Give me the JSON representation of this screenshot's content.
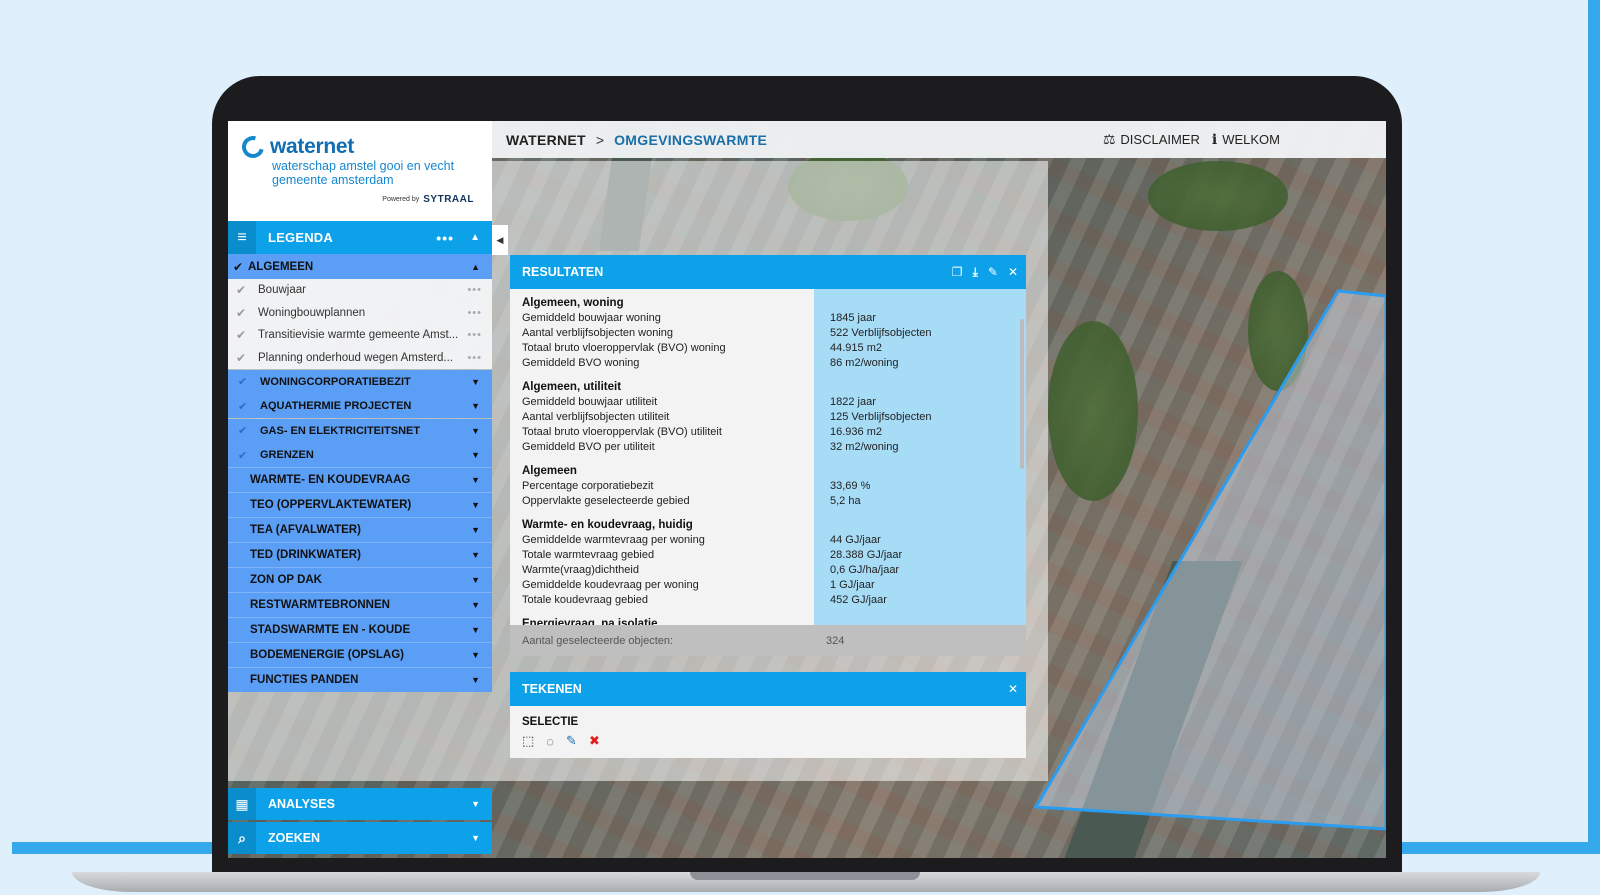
{
  "header": {
    "crumb_root": "WATERNET",
    "crumb_sep": ">",
    "crumb_current": "OMGEVINGSWARMTE",
    "disclaimer": "DISCLAIMER",
    "welkom": "WELKOM"
  },
  "logo": {
    "name": "waternet",
    "sub1": "waterschap amstel gooi en vecht",
    "sub2": "gemeente amsterdam",
    "powered_by": "Powered by",
    "vendor": "SYTRAAL"
  },
  "legend": {
    "title": "LEGENDA",
    "top": "ALGEMEEN",
    "sub_items": [
      "Bouwjaar",
      "Woningbouwplannen",
      "Transitievisie warmte gemeente Amst...",
      "Planning onderhoud wegen Amsterd..."
    ],
    "groups": [
      "WONINGCORPORATIEBEZIT",
      "AQUATHERMIE PROJECTEN",
      "GAS- EN ELEKTRICITEITSNET",
      "GRENZEN"
    ],
    "main": [
      "WARMTE- EN KOUDEVRAAG",
      "TEO (OPPERVLAKTEWATER)",
      "TEA (AFVALWATER)",
      "TED (DRINKWATER)",
      "ZON OP DAK",
      "RESTWARMTEBRONNEN",
      "STADSWARMTE EN - KOUDE",
      "BODEMENERGIE (OPSLAG)",
      "FUNCTIES PANDEN"
    ]
  },
  "bottom": {
    "analyses": "ANALYSES",
    "zoeken": "ZOEKEN"
  },
  "results": {
    "title": "RESULTATEN",
    "sections": [
      {
        "title": "Algemeen, woning",
        "rows": [
          {
            "k": "Gemiddeld bouwjaar woning",
            "v": "1845 jaar"
          },
          {
            "k": "Aantal verblijfsobjecten woning",
            "v": "522 Verblijfsobjecten"
          },
          {
            "k": "Totaal bruto vloeroppervlak (BVO) woning",
            "v": "44.915 m2"
          },
          {
            "k": "Gemiddeld BVO woning",
            "v": "86 m2/woning"
          }
        ]
      },
      {
        "title": "Algemeen, utiliteit",
        "rows": [
          {
            "k": "Gemiddeld bouwjaar utiliteit",
            "v": "1822 jaar"
          },
          {
            "k": "Aantal verblijfsobjecten utiliteit",
            "v": "125 Verblijfsobjecten"
          },
          {
            "k": "Totaal bruto vloeroppervlak (BVO) utiliteit",
            "v": "16.936 m2"
          },
          {
            "k": "Gemiddeld BVO per utiliteit",
            "v": "32 m2/woning"
          }
        ]
      },
      {
        "title": "Algemeen",
        "rows": [
          {
            "k": "Percentage corporatiebezit",
            "v": "33,69 %"
          },
          {
            "k": "Oppervlakte geselecteerde gebied",
            "v": "5,2 ha"
          }
        ]
      },
      {
        "title": "Warmte- en koudevraag, huidig",
        "rows": [
          {
            "k": "Gemiddelde warmtevraag per woning",
            "v": "44 GJ/jaar"
          },
          {
            "k": "Totale warmtevraag gebied",
            "v": "28.388 GJ/jaar"
          },
          {
            "k": "Warmte(vraag)dichtheid",
            "v": "0,6 GJ/ha/jaar"
          },
          {
            "k": "Gemiddelde koudevraag per woning",
            "v": "1 GJ/jaar"
          },
          {
            "k": "Totale koudevraag gebied",
            "v": "452 GJ/jaar"
          }
        ]
      },
      {
        "title": "Energievraag, na isolatie",
        "rows": []
      }
    ],
    "footer_label": "Aantal geselecteerde objecten:",
    "footer_value": "324"
  },
  "tekenen": {
    "title": "TEKENEN",
    "selectie": "SELECTIE"
  },
  "colors": {
    "accent": "#0ca1e8",
    "legend_row": "#5b9ef5",
    "value_column": "#a7dcf7",
    "polygon": "#2b9df0"
  },
  "icons": {
    "menu": "hamburger-icon",
    "disclaimer": "scales-icon",
    "welkom": "info-icon"
  }
}
